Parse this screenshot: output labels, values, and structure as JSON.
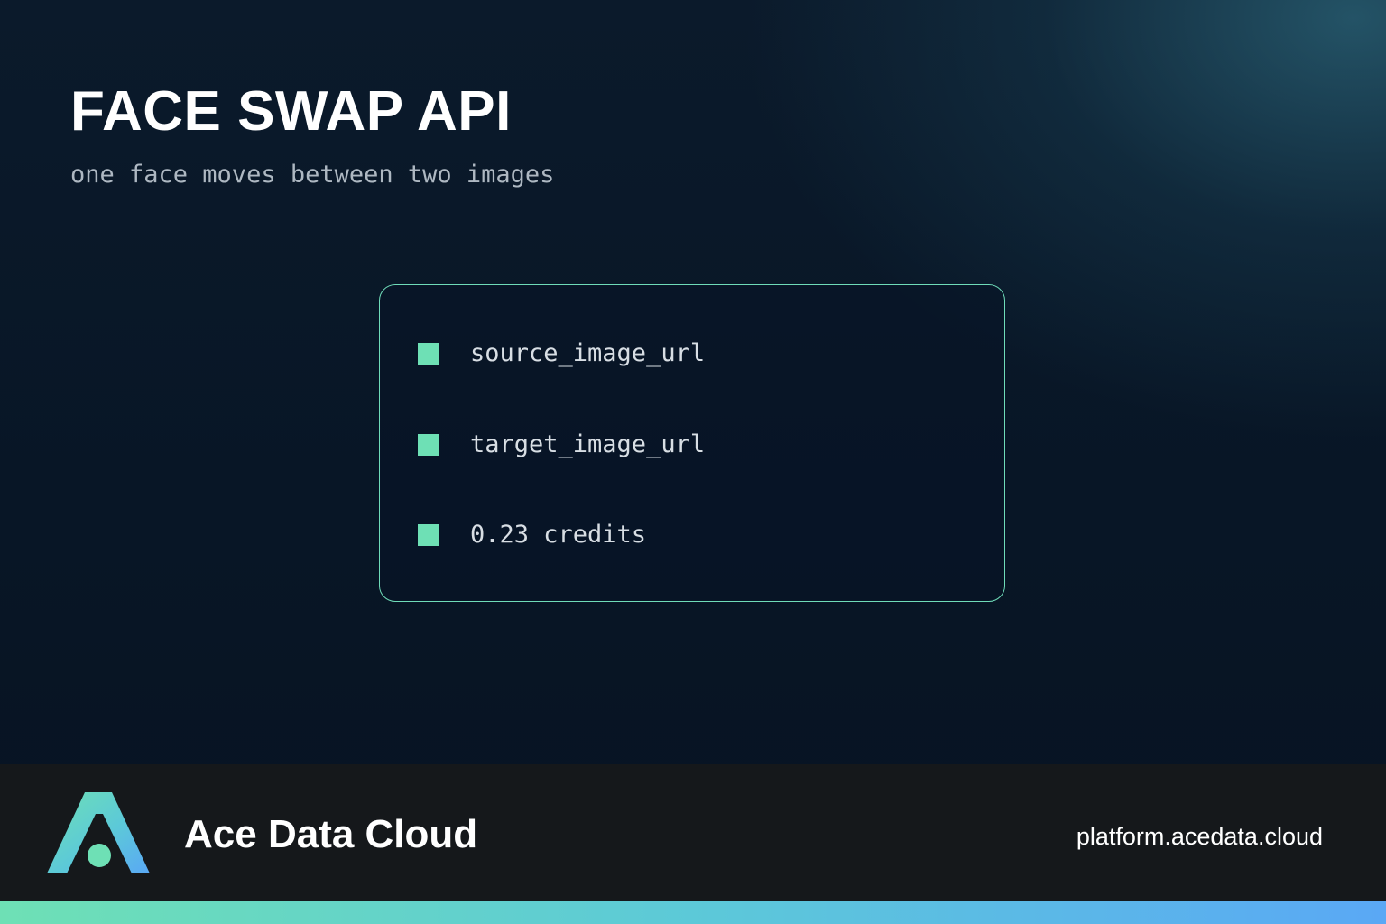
{
  "hero": {
    "title": "FACE SWAP API",
    "subtitle": "one face moves between two images"
  },
  "card": {
    "items": [
      {
        "label": "source_image_url"
      },
      {
        "label": "target_image_url"
      },
      {
        "label": "0.23 credits"
      }
    ]
  },
  "footer": {
    "brand_name": "Ace Data Cloud",
    "url": "platform.acedata.cloud"
  },
  "colors": {
    "accent_green": "#6ee0b5",
    "accent_blue": "#5aa8f5",
    "background": "#0a1626",
    "footer_background": "#15181b"
  },
  "icons": {
    "logo": "ace-data-cloud-logo",
    "bullet": "square-bullet-icon"
  }
}
